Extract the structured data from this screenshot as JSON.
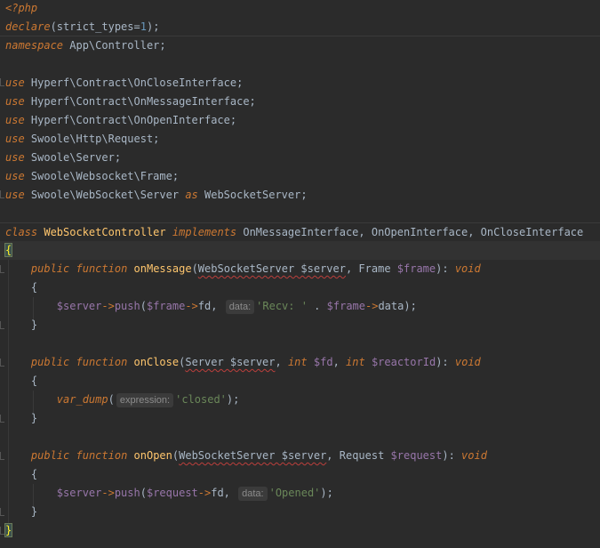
{
  "editor": {
    "language": "php",
    "colors": {
      "background": "#2b2b2b",
      "keyword": "#cc7832",
      "function": "#ffc66d",
      "variable": "#9876aa",
      "string": "#6a8759",
      "number": "#6897bb",
      "text": "#a9b7c6",
      "error_underline": "#bc3f3c"
    },
    "tokens": {
      "open_tag": "<?php",
      "declare": "declare",
      "strict_types": "(strict_types=",
      "one": "1",
      "close_paren_semi": ");",
      "namespace_kw": "namespace",
      "namespace_name": " App\\Controller;",
      "use_kw": "use",
      "use1": " Hyperf\\Contract\\OnCloseInterface;",
      "use2": " Hyperf\\Contract\\OnMessageInterface;",
      "use3": " Hyperf\\Contract\\OnOpenInterface;",
      "use4": " Swoole\\Http\\Request;",
      "use5": " Swoole\\Server;",
      "use6": " Swoole\\Websocket\\Frame;",
      "use7a": " Swoole\\WebSocket\\Server ",
      "as_kw": "as",
      "use7b": " WebSocketServer;",
      "class_kw": "class",
      "class_name": "WebSocketController",
      "implements_kw": "implements",
      "interfaces": " OnMessageInterface, OnOpenInterface, OnCloseInterface",
      "brace_open": "{",
      "brace_close": "}",
      "public_kw": "public",
      "function_kw": "function",
      "int_kw": "int",
      "void_kw": "void",
      "m1_name": "onMessage",
      "m1_type1": "WebSocketServer $server",
      "m1_mid": ", Frame ",
      "m1_var2": "$frame",
      "m1_end": "): ",
      "b1_var1": "$server",
      "arrow": "->",
      "push": "push",
      "b1_var2": "$frame",
      "b1_fd": "fd, ",
      "hint_data": "data:",
      "b1_str": "'Recv: '",
      "b1_dot": " . ",
      "b1_var3": "$frame",
      "b1_end": "data);",
      "m2_name": "onClose",
      "m2_type1": "Server $server",
      "m2_var2": "$fd",
      "m2_var3": "$reactorId",
      "b2_fn": "var_dump",
      "hint_expression": "expression:",
      "b2_str": "'closed'",
      "m3_name": "onOpen",
      "m3_type1": "WebSocketServer $server",
      "m3_mid": ", Request ",
      "m3_var2": "$request",
      "b3_var1": "$server",
      "b3_var2": "$request",
      "b3_str": "'Opened'",
      "open_paren": "(",
      "comma_space": ", ",
      "space": " ",
      "semi_end": ");"
    }
  }
}
